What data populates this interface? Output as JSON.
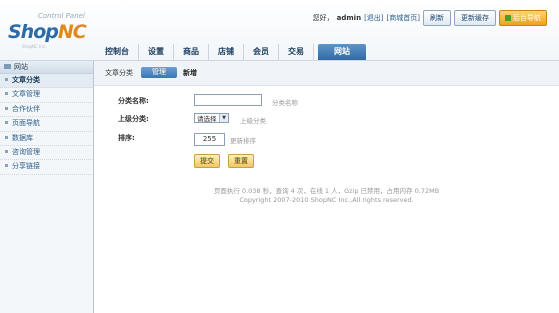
{
  "header": {
    "logo_caption": "Control Panel",
    "logo_brand_a": "Shop",
    "logo_brand_b": "NC",
    "logo_sub": "ShopNC Inc.",
    "greeting": "您好，",
    "username": "admin",
    "logout": "[退出]",
    "shop_home": "[商城首页]",
    "refresh_button": "刷新",
    "update_cache_button": "更新缓存",
    "admin_nav_button": "后台导航"
  },
  "main_nav": [
    "控制台",
    "设置",
    "商品",
    "店铺",
    "会员",
    "交易",
    "网站"
  ],
  "main_nav_active": "网站",
  "sidebar": {
    "heading": "网站",
    "items": [
      "文章分类",
      "文章管理",
      "合作伙伴",
      "页面导航",
      "数据库",
      "咨询管理",
      "分享链接"
    ],
    "active": "文章分类"
  },
  "subbar": {
    "title": "文章分类",
    "manage_tab": "管理",
    "add_tab": "新增"
  },
  "form": {
    "name_label": "分类名称:",
    "name_value": "",
    "name_hint": "分类名称",
    "parent_label": "上级分类:",
    "parent_selected": "请选择",
    "parent_hint": "上级分类",
    "sort_label": "排序:",
    "sort_value": "255",
    "sort_hint": "更新排序",
    "submit_button": "提交",
    "reset_button": "重置"
  },
  "footer": {
    "stats": "页面执行 0.038 秒，查询 4 次，在线 1 人，Gzip 已禁用，占用内存 0.72MB",
    "copyright": "Copyright 2007-2010 ShopNC Inc.,All rights reserved."
  },
  "colors": {
    "brand_blue": "#2c6aa8",
    "brand_orange": "#e08a1e",
    "active_tab": "#3a77b1"
  }
}
